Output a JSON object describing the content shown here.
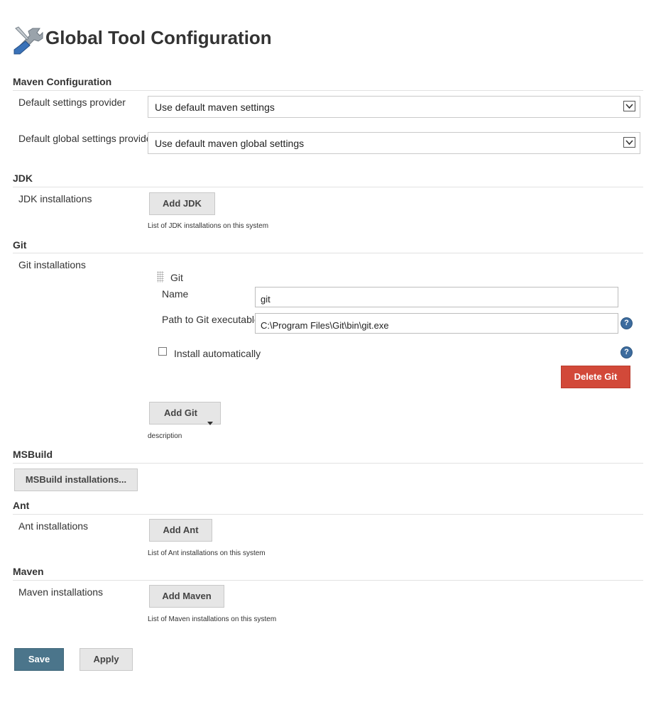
{
  "page": {
    "title": "Global Tool Configuration",
    "title_icon": "wrench-screwdriver-icon"
  },
  "maven_config": {
    "heading": "Maven Configuration",
    "default_settings_label": "Default settings provider",
    "default_settings_value": "Use default maven settings",
    "global_settings_label": "Default global settings provider",
    "global_settings_value": "Use default maven global settings"
  },
  "jdk": {
    "heading": "JDK",
    "installations_label": "JDK installations",
    "add_button": "Add JDK",
    "description": "List of JDK installations on this system"
  },
  "git": {
    "heading": "Git",
    "installations_label": "Git installations",
    "entry": {
      "title": "Git",
      "name_label": "Name",
      "name_value": "git",
      "path_label": "Path to Git executable",
      "path_value": "C:\\Program Files\\Git\\bin\\git.exe",
      "install_auto_label": "Install automatically",
      "install_auto_checked": false,
      "delete_button": "Delete Git"
    },
    "add_button": "Add Git",
    "description": "description"
  },
  "msbuild": {
    "heading": "MSBuild",
    "button": "MSBuild installations..."
  },
  "ant": {
    "heading": "Ant",
    "installations_label": "Ant installations",
    "add_button": "Add Ant",
    "description": "List of Ant installations on this system"
  },
  "maven": {
    "heading": "Maven",
    "installations_label": "Maven installations",
    "add_button": "Add Maven",
    "description": "List of Maven installations on this system"
  },
  "footer": {
    "save_button": "Save",
    "apply_button": "Apply"
  },
  "help_icon_glyph": "?",
  "colors": {
    "delete": "#d24939",
    "save": "#4b758b",
    "help": "#3d6c9e"
  }
}
